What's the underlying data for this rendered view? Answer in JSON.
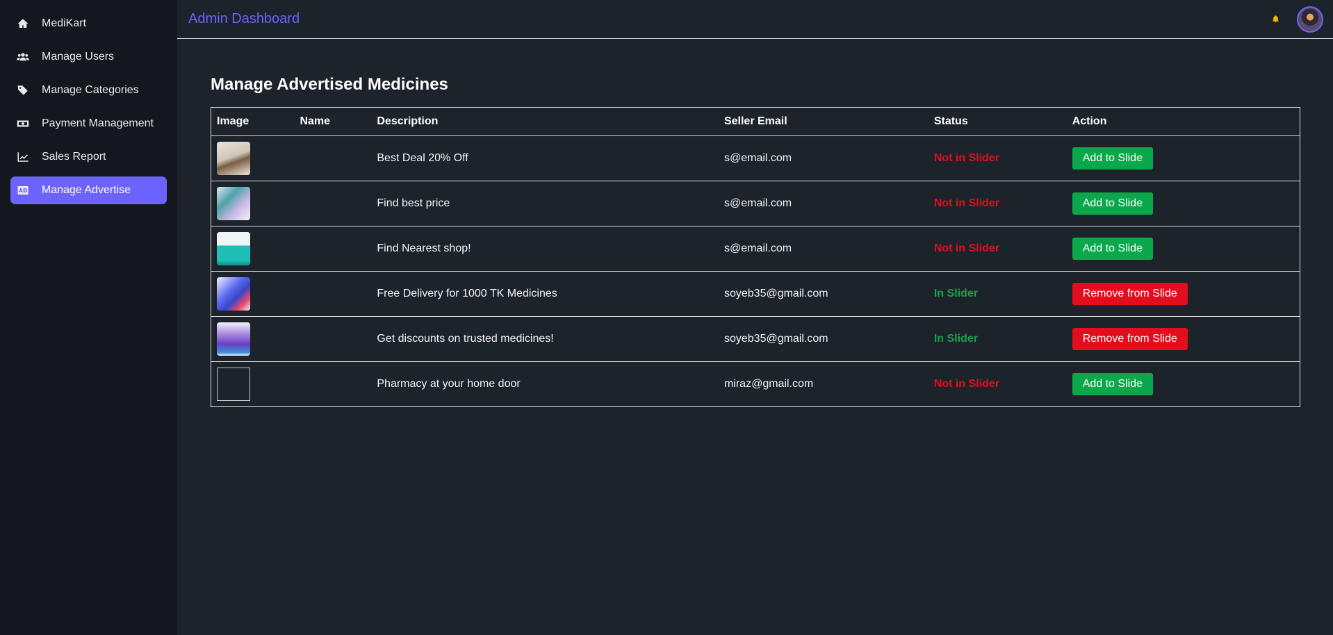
{
  "sidebar": {
    "items": [
      {
        "label": "MediKart",
        "icon": "home-icon"
      },
      {
        "label": "Manage Users",
        "icon": "users-icon"
      },
      {
        "label": "Manage Categories",
        "icon": "tags-icon"
      },
      {
        "label": "Payment Management",
        "icon": "money-bill-icon"
      },
      {
        "label": "Sales Report",
        "icon": "chart-line-icon"
      },
      {
        "label": "Manage Advertise",
        "icon": "ad-icon"
      }
    ]
  },
  "header": {
    "title": "Admin Dashboard"
  },
  "main": {
    "title": "Manage Advertised Medicines",
    "columns": [
      "Image",
      "Name",
      "Description",
      "Seller Email",
      "Status",
      "Action"
    ],
    "rows": [
      {
        "name": "",
        "description": "Best Deal 20% Off",
        "email": "s@email.com",
        "status": "Not in Slider",
        "action": "Add to Slide"
      },
      {
        "name": "",
        "description": "Find best price",
        "email": "s@email.com",
        "status": "Not in Slider",
        "action": "Add to Slide"
      },
      {
        "name": "",
        "description": "Find Nearest shop!",
        "email": "s@email.com",
        "status": "Not in Slider",
        "action": "Add to Slide"
      },
      {
        "name": "",
        "description": "Free Delivery for 1000 TK Medicines",
        "email": "soyeb35@gmail.com",
        "status": "In Slider",
        "action": "Remove from Slide"
      },
      {
        "name": "",
        "description": "Get discounts on trusted medicines!",
        "email": "soyeb35@gmail.com",
        "status": "In Slider",
        "action": "Remove from Slide"
      },
      {
        "name": "",
        "description": "Pharmacy at your home door",
        "email": "miraz@gmail.com",
        "status": "Not in Slider",
        "action": "Add to Slide"
      }
    ]
  },
  "colors": {
    "accent": "#6c63ff",
    "success": "#0aa84a",
    "danger": "#e30d1d",
    "bell": "#f5b800"
  }
}
